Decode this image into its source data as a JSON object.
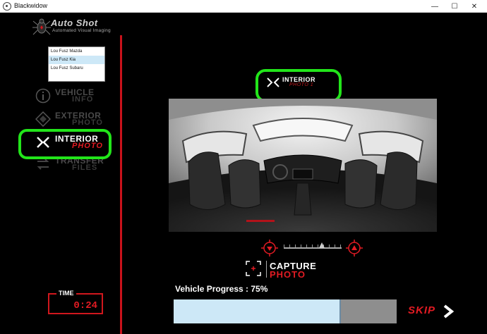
{
  "window": {
    "title": "Blackwidow",
    "minimize": "—",
    "maximize": "☐",
    "close": "✕"
  },
  "logo": {
    "brand": "Auto Shot",
    "tagline": "Automated Visual Imaging"
  },
  "dealers": {
    "items": [
      "Lou Fusz Mazda",
      "Lou Fusz Kia",
      "Lou Fusz Subaru"
    ],
    "selected_index": 1
  },
  "menu": {
    "vehicle_info": {
      "line1": "VEHICLE",
      "line2": "INFO",
      "icon": "info-icon"
    },
    "exterior_photo": {
      "line1": "EXTERIOR",
      "line2": "PHOTO",
      "icon": "diamond-icon"
    },
    "interior_photo": {
      "line1": "INTERIOR",
      "line2": "PHOTO",
      "icon": "x-icon"
    },
    "transfer_files": {
      "line1": "TRANSFER",
      "line2": "FILES",
      "icon": "transfer-icon"
    }
  },
  "timer": {
    "label": "TIME",
    "value": "0:24"
  },
  "mode": {
    "line1": "INTERIOR",
    "line2": "PHOTO 1"
  },
  "capture": {
    "line1": "CAPTURE",
    "line2": "PHOTO"
  },
  "progress": {
    "label": "Vehicle Progress : 75%",
    "percent": 75
  },
  "skip": {
    "label": "SKIP"
  },
  "colors": {
    "accent_red": "#e21b23",
    "highlight_green": "#22e51a",
    "progress_fill": "#cde8f7",
    "progress_track": "#8e8e8e"
  }
}
